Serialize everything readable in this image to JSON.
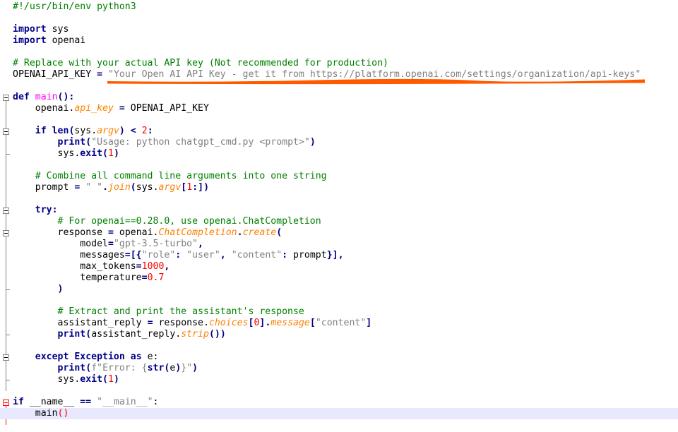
{
  "editor": {
    "current_line": 36,
    "highlight_color": "#ff5a00",
    "lines": [
      {
        "tokens": [
          {
            "t": "#!/usr/bin/env python3",
            "c": "cm"
          }
        ]
      },
      {
        "tokens": []
      },
      {
        "tokens": [
          {
            "t": "import",
            "c": "kw"
          },
          {
            "t": " sys",
            "c": "tx"
          }
        ]
      },
      {
        "tokens": [
          {
            "t": "import",
            "c": "kw"
          },
          {
            "t": " openai",
            "c": "tx"
          }
        ]
      },
      {
        "tokens": []
      },
      {
        "tokens": [
          {
            "t": "# Replace with your actual API key (Not recommended for production)",
            "c": "cm"
          }
        ]
      },
      {
        "tokens": [
          {
            "t": "OPENAI_API_KEY ",
            "c": "tx"
          },
          {
            "t": "=",
            "c": "op"
          },
          {
            "t": " ",
            "c": "tx"
          },
          {
            "t": "\"Your Open AI API Key - get it from https://platform.openai.com/settings/organization/api-keys\"",
            "c": "st"
          }
        ]
      },
      {
        "tokens": []
      },
      {
        "tokens": [
          {
            "t": "def",
            "c": "kw"
          },
          {
            "t": " ",
            "c": "tx"
          },
          {
            "t": "main",
            "c": "fn"
          },
          {
            "t": "():",
            "c": "op"
          }
        ]
      },
      {
        "tokens": [
          {
            "t": "    openai.",
            "c": "tx"
          },
          {
            "t": "api_key",
            "c": "it"
          },
          {
            "t": " ",
            "c": "tx"
          },
          {
            "t": "=",
            "c": "op"
          },
          {
            "t": " OPENAI_API_KEY",
            "c": "tx"
          }
        ]
      },
      {
        "tokens": []
      },
      {
        "tokens": [
          {
            "t": "    ",
            "c": "tx"
          },
          {
            "t": "if",
            "c": "kw"
          },
          {
            "t": " ",
            "c": "tx"
          },
          {
            "t": "len",
            "c": "bi"
          },
          {
            "t": "(",
            "c": "op"
          },
          {
            "t": "sys.",
            "c": "tx"
          },
          {
            "t": "argv",
            "c": "it"
          },
          {
            "t": ")",
            "c": "op"
          },
          {
            "t": " ",
            "c": "tx"
          },
          {
            "t": "<",
            "c": "op"
          },
          {
            "t": " ",
            "c": "tx"
          },
          {
            "t": "2",
            "c": "nu"
          },
          {
            "t": ":",
            "c": "op"
          }
        ]
      },
      {
        "tokens": [
          {
            "t": "        ",
            "c": "tx"
          },
          {
            "t": "print",
            "c": "bi"
          },
          {
            "t": "(",
            "c": "op"
          },
          {
            "t": "\"Usage: python chatgpt_cmd.py <prompt>\"",
            "c": "st"
          },
          {
            "t": ")",
            "c": "op"
          }
        ]
      },
      {
        "tokens": [
          {
            "t": "        sys.",
            "c": "tx"
          },
          {
            "t": "exit",
            "c": "bi"
          },
          {
            "t": "(",
            "c": "op"
          },
          {
            "t": "1",
            "c": "nu"
          },
          {
            "t": ")",
            "c": "op"
          }
        ]
      },
      {
        "tokens": []
      },
      {
        "tokens": [
          {
            "t": "    # Combine all command line arguments into one string",
            "c": "cm"
          }
        ]
      },
      {
        "tokens": [
          {
            "t": "    prompt ",
            "c": "tx"
          },
          {
            "t": "=",
            "c": "op"
          },
          {
            "t": " ",
            "c": "tx"
          },
          {
            "t": "\" \"",
            "c": "st"
          },
          {
            "t": ".",
            "c": "op"
          },
          {
            "t": "join",
            "c": "it"
          },
          {
            "t": "(",
            "c": "op"
          },
          {
            "t": "sys.",
            "c": "tx"
          },
          {
            "t": "argv",
            "c": "it"
          },
          {
            "t": "[",
            "c": "op"
          },
          {
            "t": "1",
            "c": "nu"
          },
          {
            "t": ":])",
            "c": "op"
          }
        ]
      },
      {
        "tokens": []
      },
      {
        "tokens": [
          {
            "t": "    ",
            "c": "tx"
          },
          {
            "t": "try",
            "c": "kw"
          },
          {
            "t": ":",
            "c": "op"
          }
        ]
      },
      {
        "tokens": [
          {
            "t": "        # For openai==0.28.0, use openai.ChatCompletion",
            "c": "cm"
          }
        ]
      },
      {
        "tokens": [
          {
            "t": "        response ",
            "c": "tx"
          },
          {
            "t": "=",
            "c": "op"
          },
          {
            "t": " openai.",
            "c": "tx"
          },
          {
            "t": "ChatCompletion",
            "c": "it"
          },
          {
            "t": ".",
            "c": "op"
          },
          {
            "t": "create",
            "c": "it"
          },
          {
            "t": "(",
            "c": "op"
          }
        ]
      },
      {
        "tokens": [
          {
            "t": "            model",
            "c": "tx"
          },
          {
            "t": "=",
            "c": "op"
          },
          {
            "t": "\"gpt-3.5-turbo\"",
            "c": "st"
          },
          {
            "t": ",",
            "c": "op"
          }
        ]
      },
      {
        "tokens": [
          {
            "t": "            messages",
            "c": "tx"
          },
          {
            "t": "=[{",
            "c": "op"
          },
          {
            "t": "\"role\"",
            "c": "st"
          },
          {
            "t": ": ",
            "c": "op"
          },
          {
            "t": "\"user\"",
            "c": "st"
          },
          {
            "t": ", ",
            "c": "op"
          },
          {
            "t": "\"content\"",
            "c": "st"
          },
          {
            "t": ": ",
            "c": "op"
          },
          {
            "t": "prompt",
            "c": "tx"
          },
          {
            "t": "}],",
            "c": "op"
          }
        ]
      },
      {
        "tokens": [
          {
            "t": "            max_tokens",
            "c": "tx"
          },
          {
            "t": "=",
            "c": "op"
          },
          {
            "t": "1000",
            "c": "nu"
          },
          {
            "t": ",",
            "c": "op"
          }
        ]
      },
      {
        "tokens": [
          {
            "t": "            temperature",
            "c": "tx"
          },
          {
            "t": "=",
            "c": "op"
          },
          {
            "t": "0.7",
            "c": "nu"
          }
        ]
      },
      {
        "tokens": [
          {
            "t": "        )",
            "c": "op"
          }
        ]
      },
      {
        "tokens": []
      },
      {
        "tokens": [
          {
            "t": "        # Extract and print the assistant's response",
            "c": "cm"
          }
        ]
      },
      {
        "tokens": [
          {
            "t": "        assistant_reply ",
            "c": "tx"
          },
          {
            "t": "=",
            "c": "op"
          },
          {
            "t": " response.",
            "c": "tx"
          },
          {
            "t": "choices",
            "c": "it"
          },
          {
            "t": "[",
            "c": "op"
          },
          {
            "t": "0",
            "c": "nu"
          },
          {
            "t": "].",
            "c": "op"
          },
          {
            "t": "message",
            "c": "it"
          },
          {
            "t": "[",
            "c": "op"
          },
          {
            "t": "\"content\"",
            "c": "st"
          },
          {
            "t": "]",
            "c": "op"
          }
        ]
      },
      {
        "tokens": [
          {
            "t": "        ",
            "c": "tx"
          },
          {
            "t": "print",
            "c": "bi"
          },
          {
            "t": "(",
            "c": "op"
          },
          {
            "t": "assistant_reply.",
            "c": "tx"
          },
          {
            "t": "strip",
            "c": "it"
          },
          {
            "t": "())",
            "c": "op"
          }
        ]
      },
      {
        "tokens": []
      },
      {
        "tokens": [
          {
            "t": "    ",
            "c": "tx"
          },
          {
            "t": "except",
            "c": "kw"
          },
          {
            "t": " ",
            "c": "tx"
          },
          {
            "t": "Exception",
            "c": "bi"
          },
          {
            "t": " ",
            "c": "tx"
          },
          {
            "t": "as",
            "c": "kw"
          },
          {
            "t": " e:",
            "c": "tx"
          }
        ]
      },
      {
        "tokens": [
          {
            "t": "        ",
            "c": "tx"
          },
          {
            "t": "print",
            "c": "bi"
          },
          {
            "t": "(",
            "c": "op"
          },
          {
            "t": "f\"Error: {",
            "c": "st"
          },
          {
            "t": "str",
            "c": "bi"
          },
          {
            "t": "(",
            "c": "op"
          },
          {
            "t": "e",
            "c": "tx"
          },
          {
            "t": ")",
            "c": "op"
          },
          {
            "t": "}\"",
            "c": "st"
          },
          {
            "t": ")",
            "c": "op"
          }
        ]
      },
      {
        "tokens": [
          {
            "t": "        sys.",
            "c": "tx"
          },
          {
            "t": "exit",
            "c": "bi"
          },
          {
            "t": "(",
            "c": "op"
          },
          {
            "t": "1",
            "c": "nu"
          },
          {
            "t": ")",
            "c": "op"
          }
        ]
      },
      {
        "tokens": []
      },
      {
        "tokens": [
          {
            "t": "if",
            "c": "kw"
          },
          {
            "t": " __name__ ",
            "c": "tx"
          },
          {
            "t": "==",
            "c": "op"
          },
          {
            "t": " ",
            "c": "tx"
          },
          {
            "t": "\"__main__\"",
            "c": "st"
          },
          {
            "t": ":",
            "c": "tx"
          }
        ]
      },
      {
        "tokens": [
          {
            "t": "    main",
            "c": "tx"
          },
          {
            "t": "()",
            "c": "nu"
          }
        ]
      }
    ]
  }
}
